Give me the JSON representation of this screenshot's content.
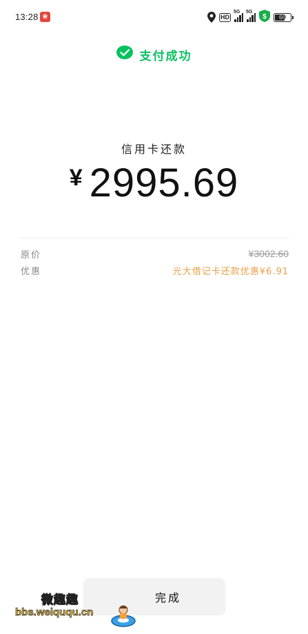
{
  "status_bar": {
    "time": "13:28",
    "hd_label": "HD",
    "signal_labels": [
      "5G",
      "5G"
    ],
    "battery_level": "60"
  },
  "header": {
    "title": "支付成功",
    "accent_color": "#07c160"
  },
  "payment": {
    "payee": "信用卡还款",
    "currency_symbol": "¥",
    "amount": "2995.69"
  },
  "details": [
    {
      "label": "原价",
      "value": "¥3002.60"
    },
    {
      "label": "优惠",
      "value": "光大借记卡还款优惠¥6.91"
    }
  ],
  "done_button": {
    "label": "完成"
  },
  "watermark": {
    "title": "微趣趣",
    "url": "bbs.weiququ.cn"
  },
  "colors": {
    "discount": "#e8a047",
    "button_bg": "#f2f2f2"
  }
}
